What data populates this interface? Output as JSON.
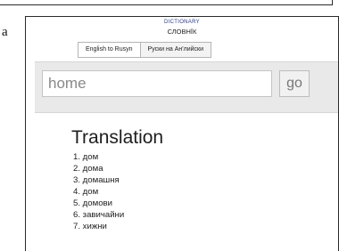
{
  "page": {
    "clipped_text": "a"
  },
  "header": {
    "title": "DICTIONARY",
    "subtitle": "СЛОВНЇК"
  },
  "tabs": [
    {
      "label": "English to Rusyn",
      "active": true
    },
    {
      "label": "Руски на Ан'лийски",
      "active": false
    }
  ],
  "search": {
    "value": "home",
    "go_label": "go"
  },
  "translation": {
    "heading": "Translation",
    "items": [
      {
        "label": "1. дом"
      },
      {
        "label": "2. дома"
      },
      {
        "label": "3. домашня"
      },
      {
        "label": "4. дом"
      },
      {
        "label": "5. домови"
      },
      {
        "label": "6. завичайни"
      },
      {
        "label": "7. хижни"
      }
    ]
  }
}
